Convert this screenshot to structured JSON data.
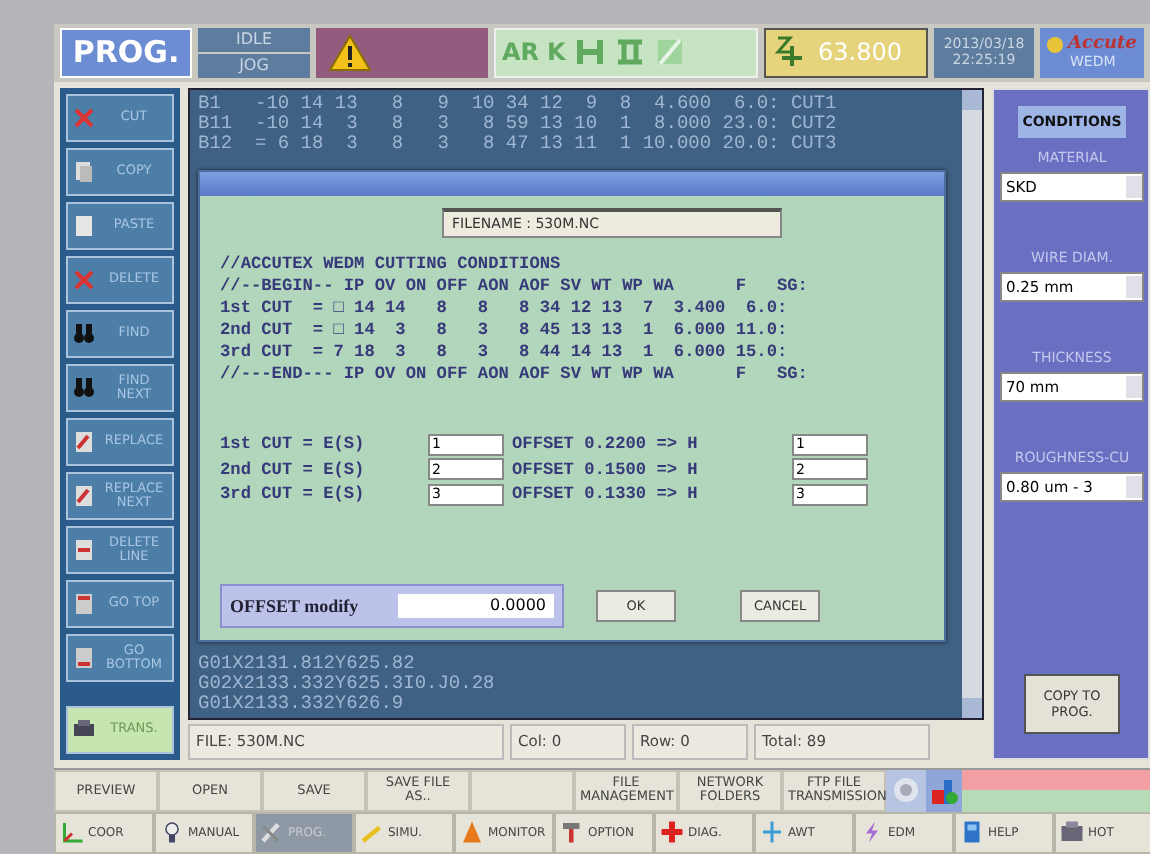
{
  "top_bar": {
    "mode": "PROG.",
    "states": [
      "IDLE",
      "JOG"
    ],
    "status_labels": [
      "AR",
      "K"
    ],
    "z_value": "63.800",
    "date": "2013/03/18",
    "time": "22:25:19",
    "logo": "Accute",
    "logo_sub": "WEDM"
  },
  "sidebar": {
    "buttons": [
      {
        "label": "CUT"
      },
      {
        "label": "COPY"
      },
      {
        "label": "PASTE"
      },
      {
        "label": "DELETE"
      },
      {
        "label": "FIND"
      },
      {
        "label": "FIND NEXT"
      },
      {
        "label": "REPLACE"
      },
      {
        "label": "REPLACE NEXT"
      },
      {
        "label": "DELETE LINE"
      },
      {
        "label": "GO TOP"
      },
      {
        "label": "GO BOTTOM"
      },
      {
        "label": "TRANS.",
        "kind": "action"
      }
    ]
  },
  "editor": {
    "lines": [
      "B1   -10 14 13   8   9  10 34 12  9  8  4.600  6.0: CUT1",
      "B11  -10 14  3   8   3   8 59 13 10  1  8.000 23.0: CUT2",
      "B12  = 6 18  3   8   3   8 47 13 11  1 10.000 20.0: CUT3"
    ],
    "bottom_lines": [
      "G01X2131.812Y625.82",
      "G02X2133.332Y625.3I0.J0.28",
      "G01X2133.332Y626.9"
    ],
    "status": {
      "file": "FILE: 530M.NC",
      "col": "Col: 0",
      "row": "Row: 0",
      "total": "Total: 89"
    }
  },
  "dialog": {
    "filename": "FILENAME : 530M.NC",
    "lines": [
      "//ACCUTEX WEDM CUTTING CONDITIONS",
      "//--BEGIN-- IP OV ON OFF AON AOF SV WT WP WA      F   SG:",
      "1st CUT  = □ 14 14   8   8   8 34 12 13  7  3.400  6.0:",
      "2nd CUT  = □ 14  3   8   3   8 45 13 13  1  6.000 11.0:",
      "3rd CUT  = 7 18  3   8   3   8 44 14 13  1  6.000 15.0:",
      "//---END--- IP OV ON OFF AON AOF SV WT WP WA      F   SG:"
    ],
    "cuts": [
      {
        "label": "1st CUT = E(S)",
        "value": "1",
        "offset": "OFFSET 0.2200 => H",
        "h_value": "1"
      },
      {
        "label": "2nd CUT = E(S)",
        "value": "2",
        "offset": "OFFSET 0.1500 => H",
        "h_value": "2"
      },
      {
        "label": "3rd CUT = E(S)",
        "value": "3",
        "offset": "OFFSET 0.1330 => H",
        "h_value": "3"
      }
    ],
    "offset_label": "OFFSET modify",
    "offset_value": "0.0000",
    "buttons": [
      "OK",
      "CANCEL"
    ]
  },
  "conditions": {
    "title": "CONDITIONS",
    "fields": [
      {
        "label": "MATERIAL",
        "value": "SKD"
      },
      {
        "label": "WIRE DIAM.",
        "value": "0.25 mm"
      },
      {
        "label": "THICKNESS",
        "value": "70 mm"
      },
      {
        "label": "ROUGHNESS-CU",
        "value": "0.80 um - 3"
      }
    ],
    "button": "COPY TO PROG."
  },
  "file_toolbar": [
    {
      "kind": "text",
      "label": "PREVIEW"
    },
    {
      "kind": "text",
      "label": "OPEN"
    },
    {
      "kind": "text",
      "label": "SAVE"
    },
    {
      "kind": "text",
      "label": "SAVE FILE AS.."
    },
    {
      "kind": "blank"
    },
    {
      "kind": "text",
      "label": "FILE MANAGEMENT"
    },
    {
      "kind": "text",
      "label": "NETWORK FOLDERS"
    },
    {
      "kind": "text",
      "label": "FTP FILE TRANSMISSION"
    },
    {
      "kind": "round"
    },
    {
      "kind": "chart"
    },
    {
      "kind": "bars"
    }
  ],
  "nav": [
    {
      "label": "COOR",
      "selected": false
    },
    {
      "label": "MANUAL",
      "selected": false
    },
    {
      "label": "PROG.",
      "selected": true
    },
    {
      "label": "SIMU.",
      "selected": false
    },
    {
      "label": "MONITOR",
      "selected": false
    },
    {
      "label": "OPTION",
      "selected": false
    },
    {
      "label": "DIAG.",
      "selected": false
    },
    {
      "label": "AWT",
      "selected": false
    },
    {
      "label": "EDM",
      "selected": false
    },
    {
      "label": "HELP",
      "selected": false
    },
    {
      "label": "HOT",
      "selected": false
    }
  ]
}
